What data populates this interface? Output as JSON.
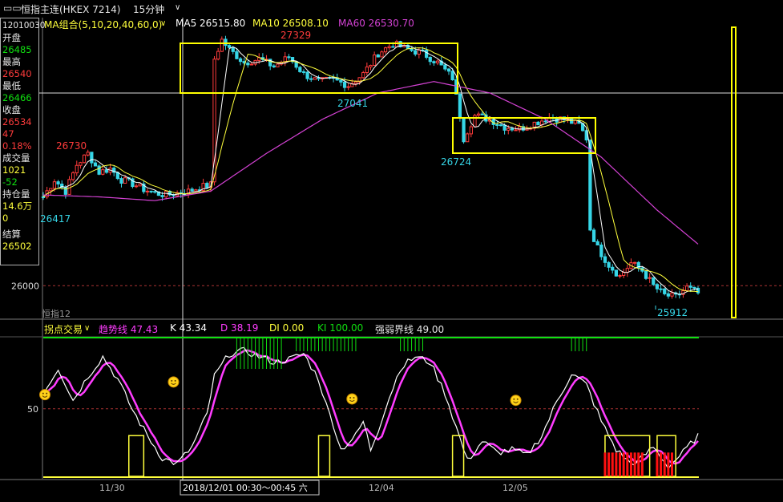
{
  "topbar": {
    "title": "恒指主连(HKEX 7214)",
    "period": "15分钟"
  },
  "ma_bar": {
    "group": "MA组合(5,10,20,40,60,0)",
    "ma5": "MA5 26515.80",
    "ma10": "MA10 26508.10",
    "ma60": "MA60 26530.70"
  },
  "info": {
    "date_code": "12010030",
    "open_label": "开盘",
    "open_value": "26485",
    "high_label": "最高",
    "high_value": "26540",
    "low_label": "最低",
    "low_value": "26466",
    "close_label": "收盘",
    "close_value": "26534",
    "change": "47",
    "change_pct": "0.18%",
    "volume_label": "成交量",
    "volume_value": "1021",
    "volume_change": "-52",
    "oi_label": "持仓量",
    "oi_value": "14.6万",
    "oi_change": "0",
    "settle_label": "结算",
    "settle_value": "26502"
  },
  "price_axis": {
    "tick_26000": "26000"
  },
  "price_annotations": {
    "high_1": "26730",
    "low_1": "26417",
    "high_2": "27329",
    "low_2": "27041",
    "low_3": "26724",
    "low_4": "25912"
  },
  "watermark": "恒指12",
  "indicator_bar": {
    "name": "拐点交易",
    "trend": "趋势线 47.43",
    "k": "K 43.34",
    "d": "D 38.19",
    "di": "DI 0.00",
    "ki": "KI 100.00",
    "strong": "强弱界线 49.00"
  },
  "indicator_axis": {
    "tick_50": "50"
  },
  "time_axis": {
    "t1": "11/30",
    "t2": "12/04",
    "t3": "12/05",
    "cursor_label": "2018/12/01 00:30～00:45 六"
  },
  "colors": {
    "up": "#ff3b3b",
    "down": "#36d6e7",
    "ma5": "#ffffff",
    "ma10": "#ffff3c",
    "ma60": "#d442d4",
    "box": "#ffff00",
    "trend": "#ff3cff",
    "k": "#ffffff",
    "signal_green": "#10e010"
  },
  "chart_data": [
    {
      "type": "candlestick",
      "title": "",
      "series": [
        {
          "name": "MA5",
          "value": 26515.8
        },
        {
          "name": "MA10",
          "value": 26508.1
        },
        {
          "name": "MA60",
          "value": 26530.7
        }
      ],
      "close_path": [
        {
          "x": 0,
          "y": 26470
        },
        {
          "x": 3,
          "y": 26560
        },
        {
          "x": 6,
          "y": 26500
        },
        {
          "x": 9,
          "y": 26640
        },
        {
          "x": 12,
          "y": 26700
        },
        {
          "x": 15,
          "y": 26600
        },
        {
          "x": 18,
          "y": 26620
        },
        {
          "x": 21,
          "y": 26560
        },
        {
          "x": 24,
          "y": 26540
        },
        {
          "x": 27,
          "y": 26510
        },
        {
          "x": 30,
          "y": 26490
        },
        {
          "x": 33,
          "y": 26480
        },
        {
          "x": 36,
          "y": 26490
        },
        {
          "x": 39,
          "y": 26500
        },
        {
          "x": 42,
          "y": 26520
        },
        {
          "x": 45,
          "y": 26534
        },
        {
          "x": 46,
          "y": 27200
        },
        {
          "x": 48,
          "y": 27300
        },
        {
          "x": 50,
          "y": 27250
        },
        {
          "x": 54,
          "y": 27180
        },
        {
          "x": 58,
          "y": 27200
        },
        {
          "x": 62,
          "y": 27160
        },
        {
          "x": 66,
          "y": 27210
        },
        {
          "x": 70,
          "y": 27120
        },
        {
          "x": 74,
          "y": 27080
        },
        {
          "x": 78,
          "y": 27090
        },
        {
          "x": 82,
          "y": 27060
        },
        {
          "x": 86,
          "y": 27120
        },
        {
          "x": 90,
          "y": 27230
        },
        {
          "x": 94,
          "y": 27280
        },
        {
          "x": 98,
          "y": 27250
        },
        {
          "x": 102,
          "y": 27230
        },
        {
          "x": 106,
          "y": 27180
        },
        {
          "x": 110,
          "y": 27100
        },
        {
          "x": 112,
          "y": 26900
        },
        {
          "x": 113,
          "y": 26780
        },
        {
          "x": 116,
          "y": 26900
        },
        {
          "x": 120,
          "y": 26880
        },
        {
          "x": 124,
          "y": 26840
        },
        {
          "x": 128,
          "y": 26830
        },
        {
          "x": 132,
          "y": 26860
        },
        {
          "x": 136,
          "y": 26890
        },
        {
          "x": 140,
          "y": 26880
        },
        {
          "x": 144,
          "y": 26850
        },
        {
          "x": 146,
          "y": 26780
        },
        {
          "x": 147,
          "y": 26300
        },
        {
          "x": 149,
          "y": 26200
        },
        {
          "x": 152,
          "y": 26110
        },
        {
          "x": 155,
          "y": 26050
        },
        {
          "x": 158,
          "y": 26120
        },
        {
          "x": 161,
          "y": 26080
        },
        {
          "x": 164,
          "y": 26000
        },
        {
          "x": 167,
          "y": 25950
        },
        {
          "x": 170,
          "y": 25940
        },
        {
          "x": 173,
          "y": 25990
        },
        {
          "x": 176,
          "y": 25960
        }
      ],
      "ma60_path": [
        {
          "x": 0,
          "y": 26480
        },
        {
          "x": 15,
          "y": 26470
        },
        {
          "x": 30,
          "y": 26450
        },
        {
          "x": 45,
          "y": 26500
        },
        {
          "x": 60,
          "y": 26700
        },
        {
          "x": 75,
          "y": 26880
        },
        {
          "x": 90,
          "y": 27020
        },
        {
          "x": 105,
          "y": 27080
        },
        {
          "x": 120,
          "y": 27020
        },
        {
          "x": 135,
          "y": 26880
        },
        {
          "x": 150,
          "y": 26680
        },
        {
          "x": 165,
          "y": 26400
        },
        {
          "x": 176,
          "y": 26220
        }
      ]
    },
    {
      "type": "line",
      "title": "",
      "series": [
        {
          "name": "趋势线",
          "value": 47.43
        },
        {
          "name": "K",
          "value": 43.34
        },
        {
          "name": "D",
          "value": 38.19
        },
        {
          "name": "DI",
          "value": 0.0
        },
        {
          "name": "KI",
          "value": 100.0
        },
        {
          "name": "强弱界线",
          "value": 49.0
        }
      ],
      "ylim": [
        0,
        100
      ]
    }
  ]
}
